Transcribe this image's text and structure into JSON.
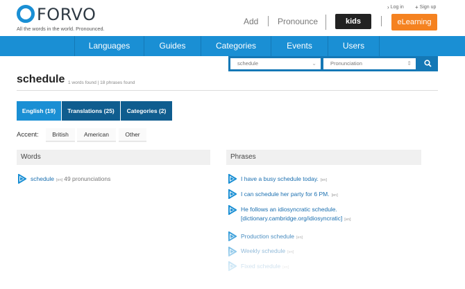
{
  "logo": {
    "word": "FORVO",
    "tagline": "All the words in the world. Pronounced."
  },
  "util": {
    "login": "Log in",
    "signup": "Sign up"
  },
  "topnav": {
    "add": "Add",
    "pronounce": "Pronounce",
    "kids": "kids",
    "elearning": "eLearning"
  },
  "nav": [
    "Languages",
    "Guides",
    "Categories",
    "Events",
    "Users"
  ],
  "search": {
    "query": "schedule",
    "mode": "Pronunciation"
  },
  "heading": {
    "title": "schedule",
    "found": "1 words found | 18 phrases found"
  },
  "tabs": [
    "English (19)",
    "Translations (25)",
    "Categories (2)"
  ],
  "accent": {
    "label": "Accent:",
    "options": [
      "British",
      "American",
      "Other"
    ]
  },
  "words": {
    "header": "Words",
    "items": [
      {
        "text": "schedule",
        "lang": "[en]",
        "pronunciations": "49 pronunciations"
      }
    ]
  },
  "phrases": {
    "header": "Phrases",
    "items": [
      {
        "text": "I have a busy schedule today.",
        "lang": "[en]"
      },
      {
        "text": "I can schedule her party for 6 PM.",
        "lang": "[en]"
      },
      {
        "text": "He follows an idiosyncratic schedule.",
        "text2": "[dictionary.cambridge.org/idiosyncratic]",
        "lang": "[en]"
      },
      {
        "text": "Production schedule",
        "lang": "[en]"
      },
      {
        "text": "Weekly schedule",
        "lang": "[en]"
      },
      {
        "text": "Fixed schedule",
        "lang": "[en]"
      }
    ]
  },
  "colors": {
    "brand_blue": "#1a8fd4",
    "dark_blue": "#0f5d8f",
    "orange": "#f58220",
    "kids_bg": "#222222"
  }
}
